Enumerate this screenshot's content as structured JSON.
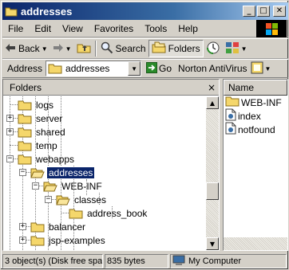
{
  "window": {
    "title": "addresses"
  },
  "titlebar_buttons": {
    "minimize": "_",
    "maximize": "□",
    "close": "✕"
  },
  "menu": [
    "File",
    "Edit",
    "View",
    "Favorites",
    "Tools",
    "Help"
  ],
  "toolbar": {
    "back": "Back",
    "search": "Search",
    "folders": "Folders"
  },
  "addressbar": {
    "label": "Address",
    "value": "addresses",
    "go": "Go",
    "norton": "Norton AntiVirus"
  },
  "folders_pane": {
    "title": "Folders",
    "close": "×",
    "tree": [
      {
        "label": "logs",
        "level": 4,
        "expander": ""
      },
      {
        "label": "server",
        "level": 4,
        "expander": "+"
      },
      {
        "label": "shared",
        "level": 4,
        "expander": "+"
      },
      {
        "label": "temp",
        "level": 4,
        "expander": ""
      },
      {
        "label": "webapps",
        "level": 4,
        "expander": "-"
      },
      {
        "label": "addresses",
        "level": 5,
        "expander": "-",
        "selected": true,
        "open": true
      },
      {
        "label": "WEB-INF",
        "level": 6,
        "expander": "-",
        "open": true
      },
      {
        "label": "classes",
        "level": 7,
        "expander": "-",
        "open": true
      },
      {
        "label": "address_book",
        "level": 8,
        "expander": ""
      },
      {
        "label": "balancer",
        "level": 5,
        "expander": "+"
      },
      {
        "label": "jsp-examples",
        "level": 5,
        "expander": "+"
      }
    ]
  },
  "files_pane": {
    "column": "Name",
    "items": [
      {
        "label": "WEB-INF",
        "icon": "folder-icon"
      },
      {
        "label": "index",
        "icon": "html-file-icon"
      },
      {
        "label": "notfound",
        "icon": "html-file-icon"
      }
    ]
  },
  "statusbar": {
    "objects": "3 object(s) (Disk free spa",
    "size": "835 bytes",
    "location": "My Computer"
  },
  "colors": {
    "title_start": "#0a246a",
    "title_end": "#a6caf0",
    "selection": "#0a246a",
    "folder": "#f5d76b"
  }
}
